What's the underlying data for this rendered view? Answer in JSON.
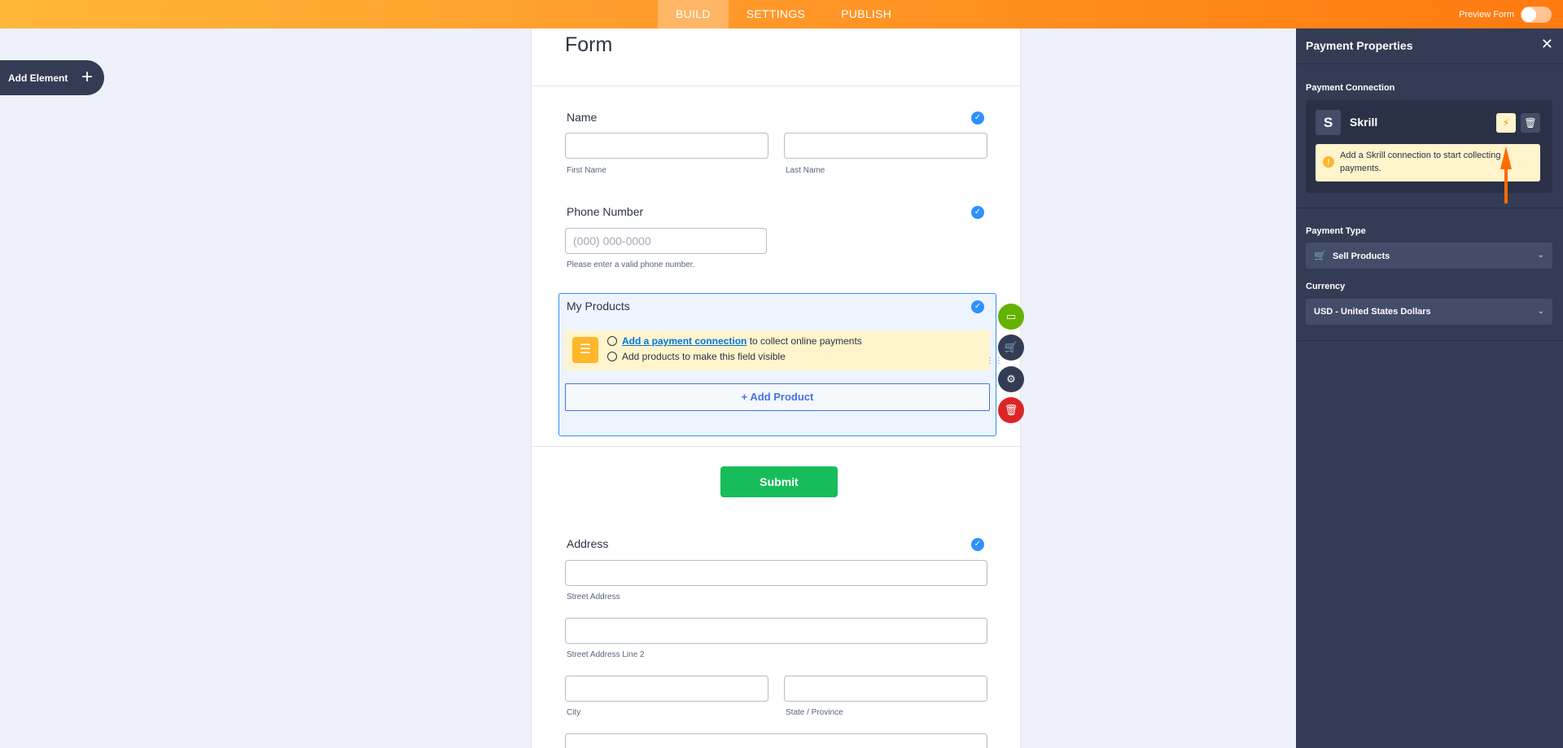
{
  "topbar": {
    "tabs": [
      "BUILD",
      "SETTINGS",
      "PUBLISH"
    ],
    "preview_label": "Preview Form"
  },
  "add_element": {
    "label": "Add Element",
    "plus": "+"
  },
  "form": {
    "title": "Form",
    "name": {
      "label": "Name",
      "first": "First Name",
      "last": "Last Name"
    },
    "phone": {
      "label": "Phone Number",
      "placeholder": "(000) 000-0000",
      "hint": "Please enter a valid phone number."
    },
    "products": {
      "label": "My Products",
      "line1_link": "Add a payment connection",
      "line1_rest": "to collect online payments",
      "line2": "Add products to make this field visible",
      "add_button": "+ Add Product"
    },
    "submit": "Submit",
    "address": {
      "label": "Address",
      "street": "Street Address",
      "street2": "Street Address Line 2",
      "city": "City",
      "state": "State / Province"
    }
  },
  "panel": {
    "title": "Payment Properties",
    "close": "✕",
    "connection_label": "Payment Connection",
    "provider_letter": "S",
    "provider_name": "Skrill",
    "warning": "Add a Skrill connection to start collecting payments.",
    "payment_type_label": "Payment Type",
    "payment_type_value": "Sell Products",
    "currency_label": "Currency",
    "currency_value": "USD - United States Dollars"
  },
  "colors": {
    "accent": "#ff7a10",
    "panel_bg": "#343c55",
    "submit": "#18bd5b",
    "check": "#2e90ff"
  }
}
